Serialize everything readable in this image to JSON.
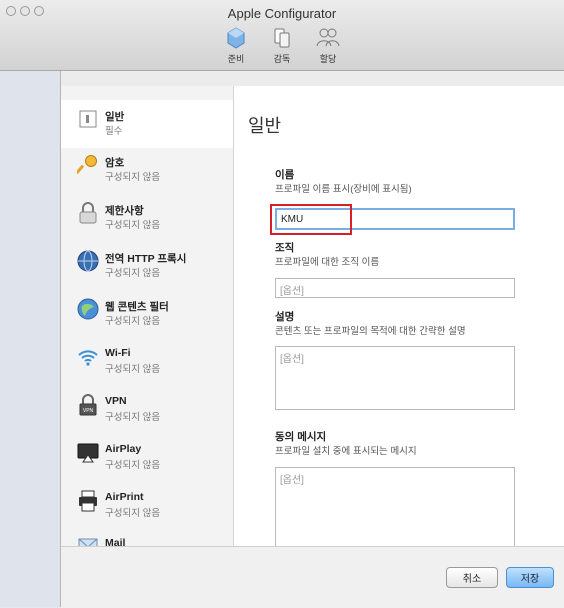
{
  "window": {
    "title": "Apple Configurator"
  },
  "toolbar": {
    "items": [
      {
        "label": "준비",
        "icon": "gem-icon"
      },
      {
        "label": "감독",
        "icon": "devices-icon"
      },
      {
        "label": "할당",
        "icon": "users-icon"
      }
    ]
  },
  "sidebar": {
    "items": [
      {
        "title": "일반",
        "subtitle": "필수",
        "icon": "general-icon",
        "selected": true
      },
      {
        "title": "암호",
        "subtitle": "구성되지 않음",
        "icon": "key-icon"
      },
      {
        "title": "제한사항",
        "subtitle": "구성되지 않음",
        "icon": "restrictions-icon"
      },
      {
        "title": "전역 HTTP 프록시",
        "subtitle": "구성되지 않음",
        "icon": "proxy-icon"
      },
      {
        "title": "웹 콘텐츠 필터",
        "subtitle": "구성되지 않음",
        "icon": "web-filter-icon"
      },
      {
        "title": "Wi-Fi",
        "subtitle": "구성되지 않음",
        "icon": "wifi-icon"
      },
      {
        "title": "VPN",
        "subtitle": "구성되지 않음",
        "icon": "vpn-icon"
      },
      {
        "title": "AirPlay",
        "subtitle": "구성되지 않음",
        "icon": "airplay-icon"
      },
      {
        "title": "AirPrint",
        "subtitle": "구성되지 않음",
        "icon": "airprint-icon"
      },
      {
        "title": "Mail",
        "subtitle": "",
        "icon": "mail-icon"
      }
    ]
  },
  "main": {
    "heading": "일반",
    "name": {
      "label": "이름",
      "description": "프로파일 이름 표시(장비에 표시됨)",
      "value": "KMU"
    },
    "organization": {
      "label": "조직",
      "description": "프로파일에 대한 조직 이름",
      "placeholder": "[옵션]"
    },
    "description": {
      "label": "설명",
      "description": "콘텐츠 또는 프로파일의 목적에 대한 간략한 설명",
      "placeholder": "[옵션]"
    },
    "consent": {
      "label": "동의 메시지",
      "description": "프로파일 설치 중에 표시되는 메시지",
      "placeholder": "[옵션]"
    }
  },
  "footer": {
    "cancel_label": "취소",
    "save_label": "저장"
  },
  "colors": {
    "accent": "#7aaee3",
    "highlight": "#d8202a"
  }
}
